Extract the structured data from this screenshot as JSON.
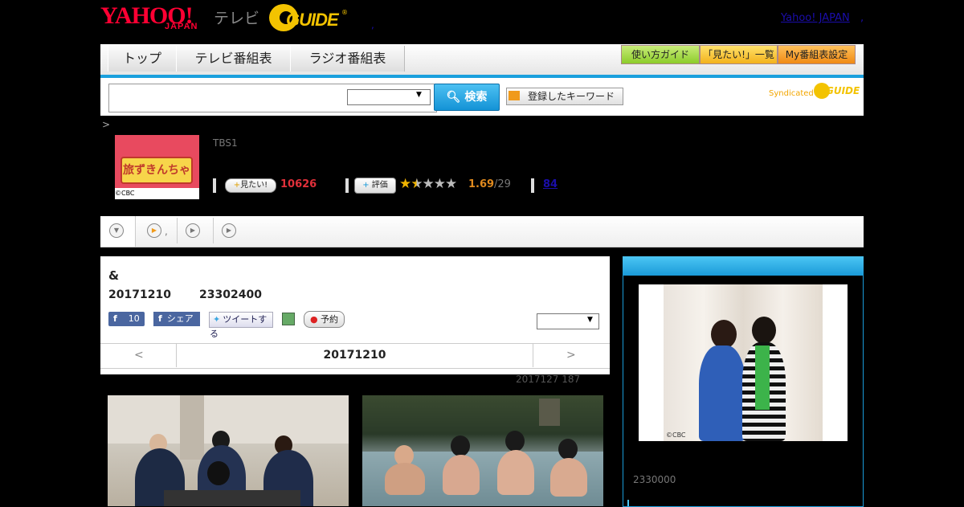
{
  "header": {
    "logo_yahoo": "YAHOO!",
    "logo_japan": "JAPAN",
    "logo_tv": "テレビ",
    "logo_guide": "GUIDE",
    "logo_reg": "®",
    "dot": ",",
    "yahoo_japan_link": "Yahoo! JAPAN",
    "link_comma": ","
  },
  "nav": {
    "tabs": [
      {
        "label": "トップ"
      },
      {
        "label": "テレビ番組表"
      },
      {
        "label": "ラジオ番組表"
      }
    ],
    "guide_buttons": [
      {
        "label": "使い方ガイド"
      },
      {
        "label": "「見たい!」一覧"
      },
      {
        "label": "My番組表設定"
      }
    ]
  },
  "search": {
    "input_value": "",
    "select_value": "",
    "search_label": "検索",
    "keyword_label": "登録したキーワード",
    "syndicated": "Syndicated",
    "syndicated_guide": "GUIDE"
  },
  "breadcrumb": ">",
  "program": {
    "thumb_title": "旅ずきんちゃ",
    "thumb_copyright": "©CBC",
    "station": "TBS1",
    "mitai_label": "見たい!",
    "mitai_count": "10626",
    "hyoka_label": "評価",
    "rating_score": "1.69",
    "rating_count": "/29",
    "review_count": "84"
  },
  "tabs": {
    "items": [
      {
        "label": ""
      },
      {
        "label": ","
      },
      {
        "label": ""
      },
      {
        "label": ""
      }
    ]
  },
  "detail": {
    "title": "&",
    "date": "20171210",
    "time": "23302400",
    "fb_like_count": "10",
    "fb_share": "シェア",
    "tweet": "ツイートする",
    "reserve": "予約",
    "select_value": "",
    "prev": "<",
    "next": ">",
    "current_date": "20171210",
    "note": "2017127  187"
  },
  "sidebar": {
    "image_copyright": "©CBC",
    "price": "2330000"
  },
  "colors": {
    "accent_blue": "#1aa0dd",
    "yahoo_red": "#ff0033",
    "guide_yellow": "#f3c300",
    "mitai_red": "#e0303a",
    "score_orange": "#e08a1e"
  }
}
